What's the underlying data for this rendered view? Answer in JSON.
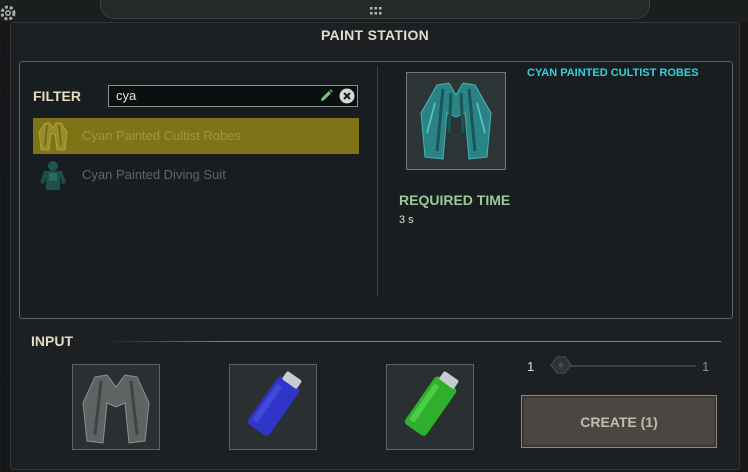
{
  "window": {
    "title": "PAINT STATION"
  },
  "filter": {
    "label": "FILTER",
    "value": "cya"
  },
  "list": [
    {
      "label": "Cyan Painted Cultist Robes",
      "selected": true
    },
    {
      "label": "Cyan Painted Diving Suit",
      "selected": false
    }
  ],
  "details": {
    "item_name": "CYAN PAINTED CULTIST ROBES",
    "required_time_label": "REQUIRED TIME",
    "required_time_value": "3 s"
  },
  "input": {
    "label": "INPUT",
    "slots": [
      "robes-icon",
      "blue-paint-icon",
      "green-paint-icon"
    ]
  },
  "quantity": {
    "min": "1",
    "max": "1",
    "value": 1
  },
  "create": {
    "label": "CREATE (1)"
  },
  "colors": {
    "accent_cyan": "#35d0e0",
    "selected_bg": "#7e7317",
    "required_green": "#9ec79a"
  }
}
